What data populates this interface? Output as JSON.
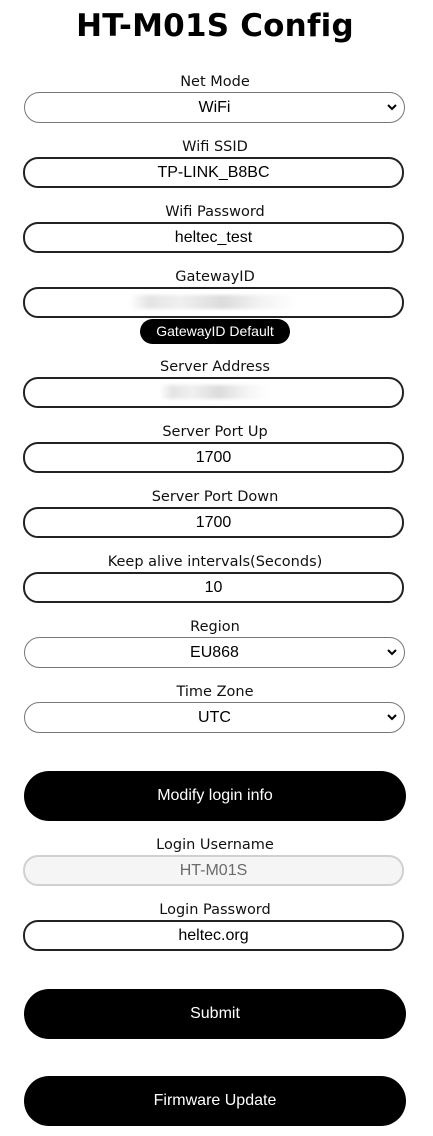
{
  "page": {
    "title": "HT-M01S Config"
  },
  "form": {
    "net_mode": {
      "label": "Net Mode",
      "value": "WiFi"
    },
    "wifi_ssid": {
      "label": "Wifi SSID",
      "value": "TP-LINK_B8BC"
    },
    "wifi_password": {
      "label": "Wifi Password",
      "value": "heltec_test"
    },
    "gateway_id": {
      "label": "GatewayID",
      "value": "",
      "default_button": "GatewayID Default"
    },
    "server_address": {
      "label": "Server Address",
      "value": ""
    },
    "server_port_up": {
      "label": "Server Port Up",
      "value": "1700"
    },
    "server_port_down": {
      "label": "Server Port Down",
      "value": "1700"
    },
    "keep_alive": {
      "label": "Keep alive intervals(Seconds)",
      "value": "10"
    },
    "region": {
      "label": "Region",
      "value": "EU868"
    },
    "time_zone": {
      "label": "Time Zone",
      "value": "UTC"
    }
  },
  "login": {
    "modify_button": "Modify login info",
    "username": {
      "label": "Login Username",
      "value": "HT-M01S"
    },
    "password": {
      "label": "Login Password",
      "value": "heltec.org"
    }
  },
  "actions": {
    "submit": "Submit",
    "firmware_update": "Firmware Update"
  }
}
